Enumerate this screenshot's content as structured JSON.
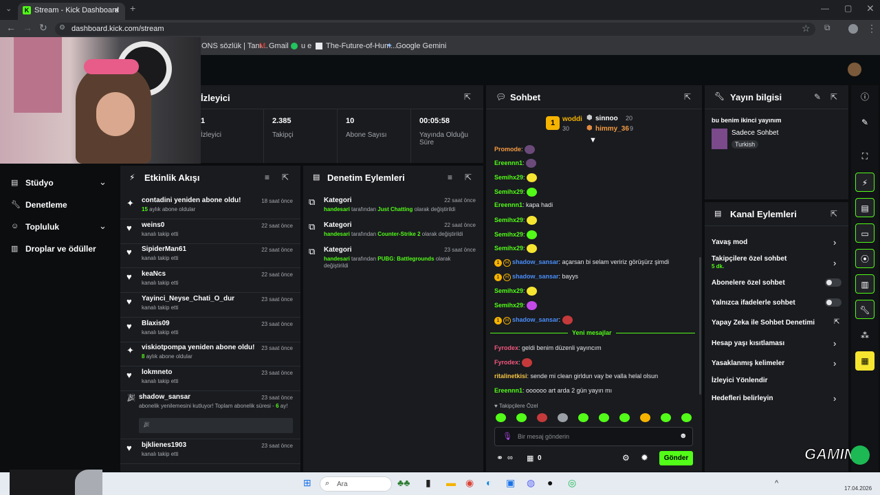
{
  "browser": {
    "tab_title": "Stream - Kick Dashboard",
    "url": "dashboard.kick.com/stream",
    "bookmarks": [
      "ONS sözlük | Tanı...",
      "Gmail",
      "u e",
      "The-Future-of-Hum...",
      "Google Gemini"
    ]
  },
  "stats": {
    "title": "İzleyici",
    "items": [
      {
        "value": "1",
        "label": "İzleyici"
      },
      {
        "value": "2.385",
        "label": "Takipçi"
      },
      {
        "value": "10",
        "label": "Abone Sayısı"
      },
      {
        "value": "00:05:58",
        "label": "Yayında Olduğu Süre"
      }
    ]
  },
  "nav": {
    "items": [
      "Stüdyo",
      "Denetleme",
      "Topluluk",
      "Droplar ve ödüller"
    ]
  },
  "activity": {
    "title": "Etkinlik Akışı",
    "rows": [
      {
        "title": "contadini yeniden abone oldu!",
        "sub_num": "15",
        "sub": "aylık abone oldular",
        "time": "18 saat önce"
      },
      {
        "title": "weins0",
        "sub": "kanalı takip etti",
        "time": "22 saat önce"
      },
      {
        "title": "SipiderMan61",
        "sub": "kanalı takip etti",
        "time": "22 saat önce"
      },
      {
        "title": "keaNcs",
        "sub": "kanalı takip etti",
        "time": "22 saat önce"
      },
      {
        "title": "Yayinci_Neyse_Chati_O_dur",
        "sub": "kanalı takip etti",
        "time": "23 saat önce"
      },
      {
        "title": "Blaxis09",
        "sub": "kanalı takip etti",
        "time": "23 saat önce"
      },
      {
        "title": "viskiotpompa yeniden abone oldu!",
        "sub_num": "8",
        "sub": "aylık abone oldular",
        "time": "23 saat önce"
      },
      {
        "title": "lokmneto",
        "sub": "kanalı takip etti",
        "time": "23 saat önce"
      },
      {
        "title": "shadow_sansar",
        "sub": "abonelik yenilemesini kutluyor! Toplam abonelik süresi -",
        "sub_num2": "6",
        "sub2": "ay!",
        "time": "23 saat önce"
      },
      {
        "title": "bjklienes1903",
        "sub": "kanalı takip etti",
        "time": "23 saat önce"
      }
    ]
  },
  "moderation": {
    "title": "Denetim Eylemleri",
    "rows": [
      {
        "title": "Kategori",
        "user": "handesari",
        "mid": "tarafından",
        "cat": "Just Chatting",
        "end": "olarak değiştirildi",
        "time": "22 saat önce"
      },
      {
        "title": "Kategori",
        "user": "handesari",
        "mid": "tarafından",
        "cat": "Counter-Strike 2",
        "end": "olarak değiştirildi",
        "time": "22 saat önce"
      },
      {
        "title": "Kategori",
        "user": "handesari",
        "mid": "tarafından",
        "cat": "PUBG: Battlegrounds",
        "end": "olarak değiştirildi",
        "time": "23 saat önce"
      }
    ]
  },
  "chat": {
    "title": "Sohbet",
    "top": [
      {
        "rank": "1",
        "name": "woddi",
        "count": "30"
      },
      {
        "name": "sinnoo",
        "count": "20"
      },
      {
        "name": "himmy_36",
        "count": "9"
      }
    ],
    "messages": [
      {
        "user": "Promode",
        "text": "",
        "color": "#f59b42"
      },
      {
        "user": "Ereennn1",
        "text": "",
        "color": "#53fc18"
      },
      {
        "user": "Semihx29",
        "text": "",
        "color": "#53fc18"
      },
      {
        "user": "Semihx29",
        "text": "",
        "color": "#53fc18"
      },
      {
        "user": "Ereennn1",
        "text": "kapa hadi",
        "color": "#53fc18"
      },
      {
        "user": "Semihx29",
        "text": "",
        "color": "#53fc18"
      },
      {
        "user": "Semihx29",
        "text": "",
        "color": "#53fc18"
      },
      {
        "user": "Semihx29",
        "text": "",
        "color": "#53fc18"
      },
      {
        "user": "shadow_sansar",
        "text": "açarsan bi selam veririz görüşürz şimdi",
        "color": "#4b8df8"
      },
      {
        "user": "shadow_sansar",
        "text": "bayys",
        "color": "#4b8df8"
      },
      {
        "user": "Semihx29",
        "text": "",
        "color": "#53fc18"
      },
      {
        "user": "Semihx29",
        "text": "",
        "color": "#53fc18"
      },
      {
        "user": "shadow_sansar",
        "text": "",
        "color": "#4b8df8"
      }
    ],
    "new_label": "Yeni mesajlar",
    "messages2": [
      {
        "user": "Fyrodex",
        "text": "geldi benim düzenli yayıncım",
        "color": "#f2577e"
      },
      {
        "user": "Fyrodex",
        "text": "",
        "color": "#f2577e"
      },
      {
        "user": "ritalinetkisi",
        "text": "sende mi clean girldun vay be valla helal olsun",
        "color": "#f5c342"
      },
      {
        "user": "Ereennn1",
        "text": "oooooo art arda 2 gün yayın mı",
        "color": "#53fc18"
      }
    ],
    "emote_label": "Takipçilere Özel",
    "placeholder": "Bir mesaj gönderin",
    "send": "Gönder",
    "points": "0"
  },
  "info": {
    "title": "Yayın bilgisi",
    "stream_title": "bu benim ikinci yayınım",
    "category": "Sadece Sohbet",
    "tag": "Turkish"
  },
  "actions": {
    "title": "Kanal Eylemleri",
    "items": [
      {
        "label": "Yavaş mod"
      },
      {
        "label": "Takipçilere özel sohbet",
        "sub": "5 dk."
      },
      {
        "label": "Abonelere özel sohbet"
      },
      {
        "label": "Yalnızca ifadelerle sohbet"
      },
      {
        "label": "Yapay Zeka ile Sohbet Denetimi"
      },
      {
        "label": "Hesap yaşı kısıtlaması"
      },
      {
        "label": "Yasaklanmış kelimeler"
      },
      {
        "label": "İzleyici Yönlendir"
      },
      {
        "label": "Hedefleri belirleyin"
      }
    ]
  },
  "taskbar": {
    "search": "Ara",
    "overlay": "GAMING",
    "date": "17.04.2026"
  },
  "colors": {
    "accent": "#53fc18",
    "panel": "#191b1f",
    "bg": "#0b0d0f"
  }
}
